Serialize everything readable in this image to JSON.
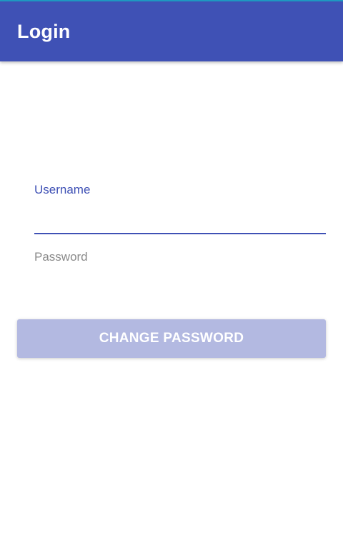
{
  "app_bar": {
    "title": "Login"
  },
  "form": {
    "username": {
      "label": "Username",
      "value": ""
    },
    "password": {
      "label": "Password",
      "value": ""
    },
    "change_password_label": "CHANGE PASSWORD"
  },
  "colors": {
    "primary": "#3f51b5",
    "accent_top": "#1f9bc4",
    "button_disabled": "#b3b9e1",
    "label_inactive": "#8a8a8a"
  }
}
